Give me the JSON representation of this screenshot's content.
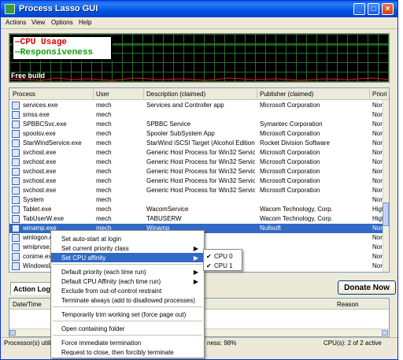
{
  "window": {
    "title": "Process Lasso GUI",
    "min": "_",
    "max": "□",
    "close": "×"
  },
  "menu": [
    "Actions",
    "View",
    "Options",
    "Help"
  ],
  "graph": {
    "legend_cpu": "CPU Usage",
    "legend_resp": "Responsiveness",
    "free_build": "Free build",
    "cpu_color": "#dd0000",
    "resp_color": "#00aa00"
  },
  "columns": [
    "Process",
    "User",
    "Description (claimed)",
    "Publisher (claimed)",
    "Priori"
  ],
  "processes": [
    {
      "name": "services.exe",
      "user": "mech",
      "desc": "Services and Controller app",
      "pub": "Microsoft Corporation",
      "prio": "Norm"
    },
    {
      "name": "smss.exe",
      "user": "mech",
      "desc": "",
      "pub": "",
      "prio": "Norm"
    },
    {
      "name": "SPBBCSvc.exe",
      "user": "mech",
      "desc": "SPBBC Service",
      "pub": "Symantec Corporation",
      "prio": "Norm"
    },
    {
      "name": "spoolsv.exe",
      "user": "mech",
      "desc": "Spooler SubSystem App",
      "pub": "Microsoft Corporation",
      "prio": "Norm"
    },
    {
      "name": "StarWindService.exe",
      "user": "mech",
      "desc": "StarWind iSCSI Target (Alcohol Edition)",
      "pub": "Rocket Division Software",
      "prio": "Norm"
    },
    {
      "name": "svchost.exe",
      "user": "mech",
      "desc": "Generic Host Process for Win32 Services",
      "pub": "Microsoft Corporation",
      "prio": "Norm"
    },
    {
      "name": "svchost.exe",
      "user": "mech",
      "desc": "Generic Host Process for Win32 Services",
      "pub": "Microsoft Corporation",
      "prio": "Norm"
    },
    {
      "name": "svchost.exe",
      "user": "mech",
      "desc": "Generic Host Process for Win32 Services",
      "pub": "Microsoft Corporation",
      "prio": "Norm"
    },
    {
      "name": "svchost.exe",
      "user": "mech",
      "desc": "Generic Host Process for Win32 Services",
      "pub": "Microsoft Corporation",
      "prio": "Norm"
    },
    {
      "name": "svchost.exe",
      "user": "mech",
      "desc": "Generic Host Process for Win32 Services",
      "pub": "Microsoft Corporation",
      "prio": "Norm"
    },
    {
      "name": "System",
      "user": "mech",
      "desc": "",
      "pub": "",
      "prio": "Norm"
    },
    {
      "name": "Tablet.exe",
      "user": "mech",
      "desc": "WacomService",
      "pub": "Wacom Technology, Corp.",
      "prio": "High"
    },
    {
      "name": "TabUserW.exe",
      "user": "mech",
      "desc": "TABUSERW",
      "pub": "Wacom Technology, Corp.",
      "prio": "High"
    },
    {
      "name": "winamp.exe",
      "user": "mech",
      "desc": "Winamp",
      "pub": "Nullsoft",
      "prio": "Norm"
    },
    {
      "name": "winlogon.e",
      "user": "",
      "desc": "",
      "pub": "",
      "prio": "Norm"
    },
    {
      "name": "wmiprvse.",
      "user": "",
      "desc": "",
      "pub": "",
      "prio": "Norm"
    },
    {
      "name": "conime.exe",
      "user": "",
      "desc": "",
      "pub": "",
      "prio": "Norm"
    },
    {
      "name": "WindowsLiv",
      "user": "",
      "desc": "",
      "pub": "",
      "prio": "Norm"
    }
  ],
  "action_log": {
    "tab": "Action Log",
    "donate": "Donate Now",
    "col_date": "Date/Time",
    "col_reason": "Reason"
  },
  "status": {
    "left": "Processor(s) utiliz",
    "mid": "ness: 98%",
    "right": "CPU(s): 2 of 2 active"
  },
  "context_menu": [
    {
      "label": "Set auto-start at login",
      "arrow": ""
    },
    {
      "label": "Set current priority class",
      "arrow": "▶"
    },
    {
      "label": "Set CPU affinity",
      "arrow": "▶"
    },
    {
      "label": "Default priority (each time run)",
      "arrow": "▶"
    },
    {
      "label": "Default CPU Affinity (each time run)",
      "arrow": "▶"
    },
    {
      "label": "Exclude from out-of-control restraint",
      "arrow": ""
    },
    {
      "label": "Terminate always (add to disallowed processes)",
      "arrow": ""
    },
    {
      "label": "Temporarily trim working set (force page out)",
      "arrow": ""
    },
    {
      "label": "Open containing folder",
      "arrow": ""
    },
    {
      "label": "Force immediate termination",
      "arrow": ""
    },
    {
      "label": "Request to close, then forcibly terminate",
      "arrow": ""
    }
  ],
  "submenu": [
    {
      "label": "CPU 0",
      "check": "✔"
    },
    {
      "label": "CPU 1",
      "check": "✔"
    }
  ]
}
